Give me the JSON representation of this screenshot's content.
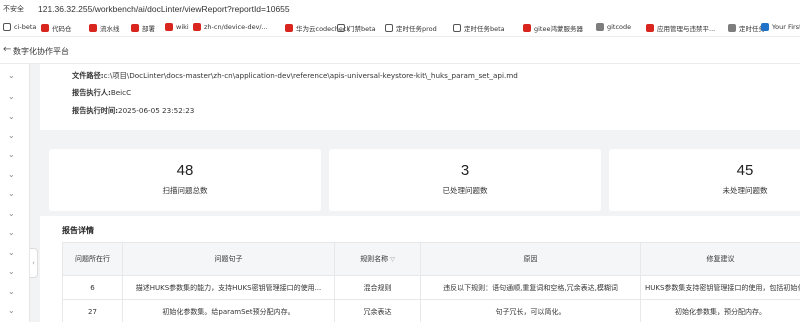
{
  "browser": {
    "insecure_label": "不安全",
    "url": "121.36.32.255/workbench/ai/docLinter/viewReport?reportId=10655",
    "bookmarks": [
      {
        "label": "ci-beta",
        "icon": "globe-icon"
      },
      {
        "label": "代码仓",
        "icon": "huawei-icon"
      },
      {
        "label": "流水线",
        "icon": "huawei-icon"
      },
      {
        "label": "部署",
        "icon": "huawei-icon"
      },
      {
        "label": "wiki",
        "icon": "huawei-icon"
      },
      {
        "label": "zh-cn/device-dev/...",
        "icon": "huawei-icon"
      },
      {
        "label": "华为云codecheck",
        "icon": "huawei-icon"
      },
      {
        "label": "门禁beta",
        "icon": "globe-icon"
      },
      {
        "label": "定时任务prod",
        "icon": "globe-icon"
      },
      {
        "label": "定时任务beta",
        "icon": "globe-icon"
      },
      {
        "label": "gitee鸿蒙服务器",
        "icon": "huawei-icon"
      },
      {
        "label": "gitcode",
        "icon": "folder-icon"
      },
      {
        "label": "应用管理与违禁平...",
        "icon": "huawei-icon"
      },
      {
        "label": "定时任务",
        "icon": "folder-icon"
      },
      {
        "label": "Your First Extensio...",
        "icon": "vscode-icon"
      }
    ]
  },
  "app": {
    "back_glyph": "←",
    "title": "数字化协作平台"
  },
  "report_info": {
    "path_label": "文件路径:",
    "path_value": "c:\\项目\\DocLinter\\docs-master\\zh-cn\\application-dev\\reference\\apis-universal-keystore-kit\\_huks_param_set_api.md",
    "executor_label": "报告执行人:",
    "executor_value": "BeicC",
    "time_label": "报告执行时间:",
    "time_value": "2025-06-05 23:52:23"
  },
  "stats": [
    {
      "value": "48",
      "label": "扫描问题总数"
    },
    {
      "value": "3",
      "label": "已处理问题数"
    },
    {
      "value": "45",
      "label": "未处理问题数"
    }
  ],
  "details": {
    "title": "报告详情",
    "columns": [
      "问题所在行",
      "问题句子",
      "规则名称",
      "原因",
      "修复建议"
    ],
    "rows": [
      {
        "line": "6",
        "sentence": "描述HUKS参数集的能力，支持HUKS密钥管理接口的使用...",
        "rule": "混合规则",
        "reason": "违反以下规则：语句通顺,重复词和空格,冗余表达,模糊词",
        "fix": "HUKS参数集支持密钥管理接口的使用，包括初始化"
      },
      {
        "line": "27",
        "sentence": "初始化参数集。给paramSet预分配内存。",
        "rule": "冗余表达",
        "reason": "句子冗长，可以简化。",
        "fix": "初始化参数集，预分配内存。"
      }
    ]
  },
  "colors": {
    "page_bg": "#f2f3f5",
    "card_bg": "#ffffff",
    "table_header_bg": "#f5f6f8"
  }
}
